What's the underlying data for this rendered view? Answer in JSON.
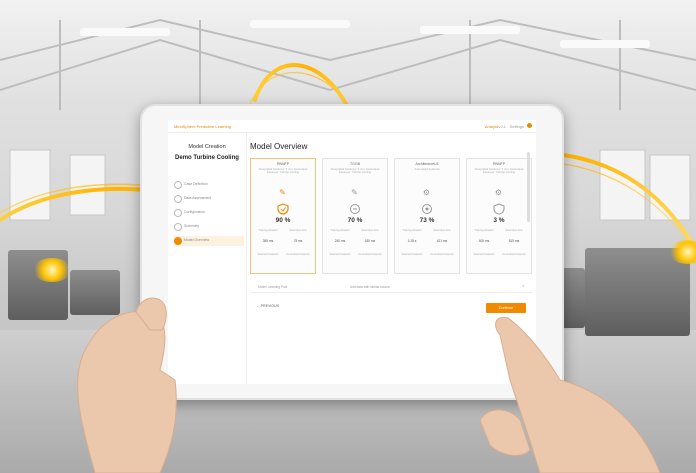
{
  "app": {
    "brand": "MindSphere Predictive Learning",
    "user": "Analyst",
    "version": "v2.1",
    "settings": "Settings",
    "accent": "#f08a00"
  },
  "sidebar": {
    "title": "Model Creation",
    "project": "Demo Turbine Cooling",
    "steps": [
      {
        "label": "Case Definition",
        "active": false
      },
      {
        "label": "Data Assessment",
        "active": false
      },
      {
        "label": "Configuration",
        "active": false
      },
      {
        "label": "Summary",
        "active": false
      },
      {
        "label": "Model Overview",
        "active": true
      }
    ]
  },
  "main": {
    "heading": "Model Overview",
    "cards": [
      {
        "algo": "RNNFP",
        "desc": "Automated Features: 3 min, Automated Features: Turbine Cooling",
        "pct": "90 %",
        "m1_label": "Training duration",
        "m1_val": "355 ms",
        "m2_label": "Execution time",
        "m2_val": "75 ms",
        "m3_label": "Selected Features",
        "m4_label": "Generated Features",
        "best": true
      },
      {
        "algo": "TGGB",
        "desc": "Automated Features: 2 min, Automated Features: Turbine Cooling",
        "pct": "70 %",
        "m1_label": "Training duration",
        "m1_val": "240 ms",
        "m2_label": "Execution time",
        "m2_val": "180 ms",
        "m3_label": "Selected Features",
        "m4_label": "Generated Features",
        "best": false
      },
      {
        "algo": "ArchitectureLS",
        "desc": "Automated Features",
        "pct": "73 %",
        "m1_label": "Training duration",
        "m1_val": "1:28 s",
        "m2_label": "Execution time",
        "m2_val": "421 ms",
        "m3_label": "Selected Features",
        "m4_label": "Generated Features",
        "best": false
      },
      {
        "algo": "RNNFP",
        "desc": "Automated Features: 3 min, Automated Features: Turbine Cooling",
        "pct": "3 %",
        "m1_label": "Training duration",
        "m1_val": "405 ms",
        "m2_label": "Execution time",
        "m2_val": "815 ms",
        "m3_label": "Selected Features",
        "m4_label": "Generated Features",
        "best": false
      }
    ],
    "pool_label": "Model Learning Pool",
    "pool_value": "Add data with similar source",
    "previous": "PREVIOUS",
    "continue": "Continue"
  }
}
